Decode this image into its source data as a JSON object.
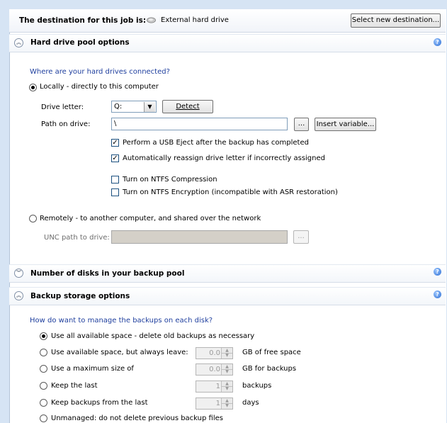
{
  "destination": {
    "label": "The destination for this job is:",
    "value": "External hard drive",
    "select_button": "Select new destination..."
  },
  "pool_section": {
    "title": "Hard drive pool options",
    "question": "Where are your hard drives connected?",
    "local_option": "Locally - directly to this computer",
    "drive_letter_label": "Drive letter:",
    "drive_letter_value": "Q:",
    "detect_button": "Detect",
    "path_label": "Path on drive:",
    "path_value": "\\",
    "browse_button": "...",
    "insert_variable_button": "Insert variable...",
    "usb_eject": "Perform a USB Eject after the backup has completed",
    "reassign_letter": "Automatically reassign drive letter if incorrectly assigned",
    "ntfs_compression": "Turn on NTFS Compression",
    "ntfs_encryption": "Turn on NTFS Encryption (incompatible with ASR restoration)",
    "remote_option": "Remotely - to another computer, and shared over the network",
    "unc_label": "UNC path to drive:",
    "unc_value": "",
    "unc_browse_button": "..."
  },
  "disks_section": {
    "title": "Number of disks in your backup pool"
  },
  "storage_section": {
    "title": "Backup storage options",
    "question": "How do want to manage the backups on each disk?",
    "options": [
      {
        "label": "Use all available space - delete old backups as necessary",
        "selected": true
      },
      {
        "label": "Use available space, but always leave:",
        "value": "0.0",
        "unit": "GB of free space"
      },
      {
        "label": "Use a maximum size of",
        "value": "0.0",
        "unit": "GB for backups"
      },
      {
        "label": "Keep the last",
        "value": "1",
        "unit": "backups"
      },
      {
        "label": "Keep backups from the last",
        "value": "1",
        "unit": "days"
      },
      {
        "label": "Unmanaged: do not delete previous backup files"
      }
    ]
  },
  "icons": {
    "drive": "external-drive-icon",
    "collapse": "chevron-up-icon",
    "expand": "chevron-down-icon",
    "help": "help-icon"
  }
}
